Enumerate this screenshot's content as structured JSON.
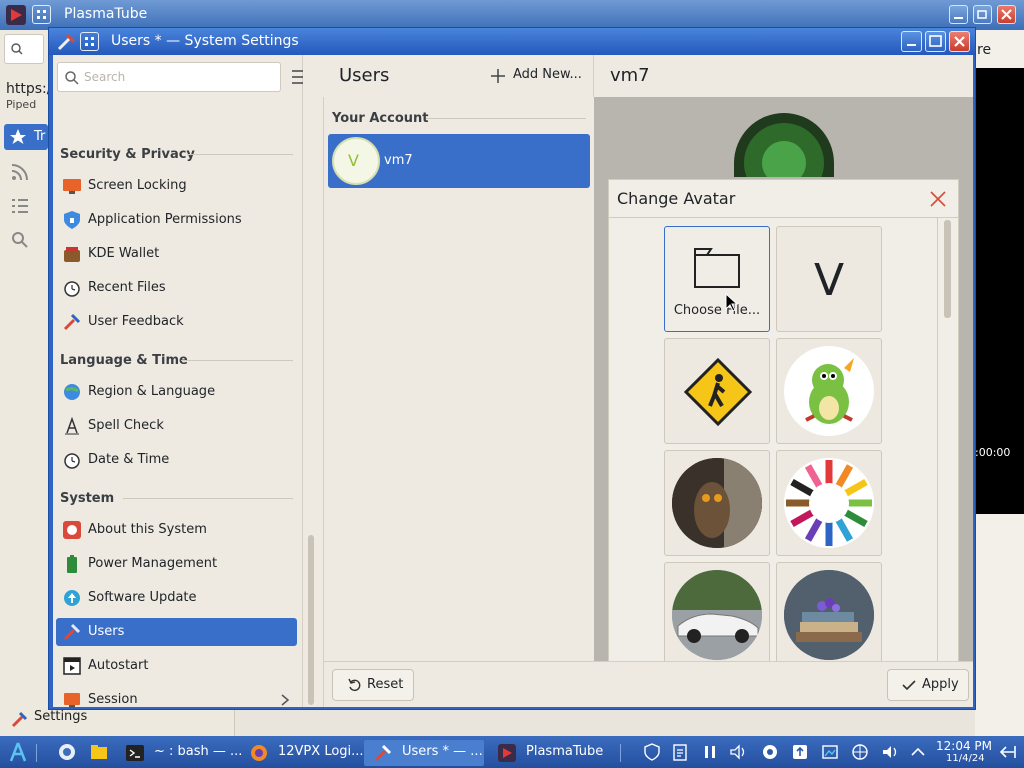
{
  "background_app": {
    "title": "PlasmaTube",
    "url_partial": "https:/",
    "subtitle": "Piped",
    "nav_partial": "Tr",
    "right_partial": "re",
    "video_time": ":00:00",
    "bottom_item": "Settings"
  },
  "window": {
    "title": "Users * — System Settings"
  },
  "sidebar": {
    "search_placeholder": "Search",
    "sections": [
      {
        "title": "Security & Privacy",
        "items": [
          "Screen Locking",
          "Application Permissions",
          "KDE Wallet",
          "Recent Files",
          "User Feedback"
        ]
      },
      {
        "title": "Language & Time",
        "items": [
          "Region & Language",
          "Spell Check",
          "Date & Time"
        ]
      },
      {
        "title": "System",
        "items": [
          "About this System",
          "Power Management",
          "Software Update",
          "Users",
          "Autostart",
          "Session"
        ]
      }
    ],
    "selected": "Users"
  },
  "users_page": {
    "title": "Users",
    "add_new": "Add New...",
    "your_account": "Your Account",
    "user_name": "vm7",
    "user_initial": "V",
    "detail_title": "vm7"
  },
  "dialog": {
    "title": "Change Avatar",
    "choose_file": "Choose File...",
    "initial_tile": "V"
  },
  "footer": {
    "reset": "Reset",
    "apply": "Apply"
  },
  "taskbar": {
    "tasks": [
      "~ : bash — ...",
      "12VPX Logi...",
      "Users * — ...",
      "PlasmaTube"
    ],
    "time": "12:04 PM",
    "date": "11/4/24"
  },
  "colors": {
    "accent": "#3a6fc9",
    "titlebar": "#2458bb",
    "close": "#d94a3b"
  }
}
